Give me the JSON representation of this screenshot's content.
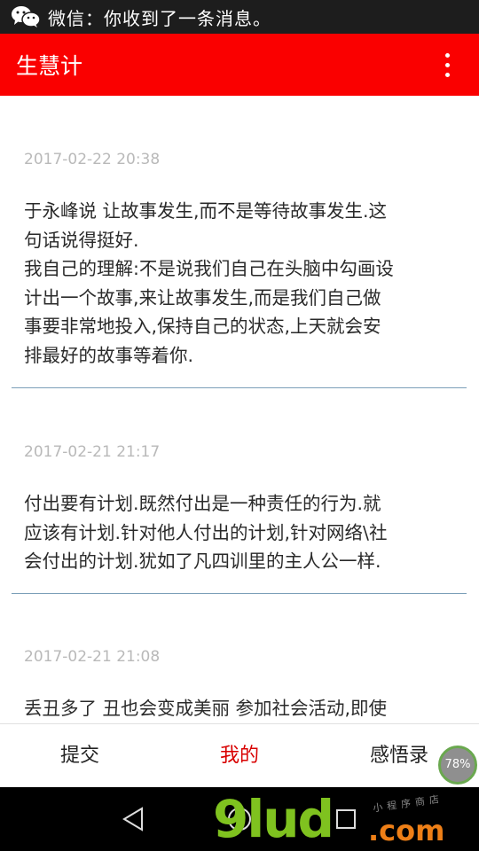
{
  "status": {
    "text": "微信：你收到了一条消息。"
  },
  "appbar": {
    "title": "生慧计"
  },
  "entries": [
    {
      "date": "2017-02-22 20:38",
      "text": "于永峰说 让故事发生,而不是等待故事发生.这\n句话说得挺好.\n我自己的理解:不是说我们自己在头脑中勾画设\n计出一个故事,来让故事发生,而是我们自己做\n事要非常地投入,保持自己的状态,上天就会安\n排最好的故事等着你."
    },
    {
      "date": "2017-02-21 21:17",
      "text": "付出要有计划.既然付出是一种责任的行为.就\n应该有计划.针对他人付出的计划,针对网络\\社\n会付出的计划.犹如了凡四训里的主人公一样."
    },
    {
      "date": "2017-02-21 21:08",
      "text": "丢丑多了 丑也会变成美丽 参加社会活动,即使"
    }
  ],
  "tabs": [
    {
      "label": "提交"
    },
    {
      "label": "我的"
    },
    {
      "label": "感悟录"
    }
  ],
  "badge": {
    "text": "78%"
  },
  "watermark": {
    "main": "9lud",
    "suffix": ".com",
    "small": "小程序商店"
  },
  "colors": {
    "appbar": "#fa0000",
    "active_tab": "#d80000",
    "divider": "#7b9fb8"
  }
}
